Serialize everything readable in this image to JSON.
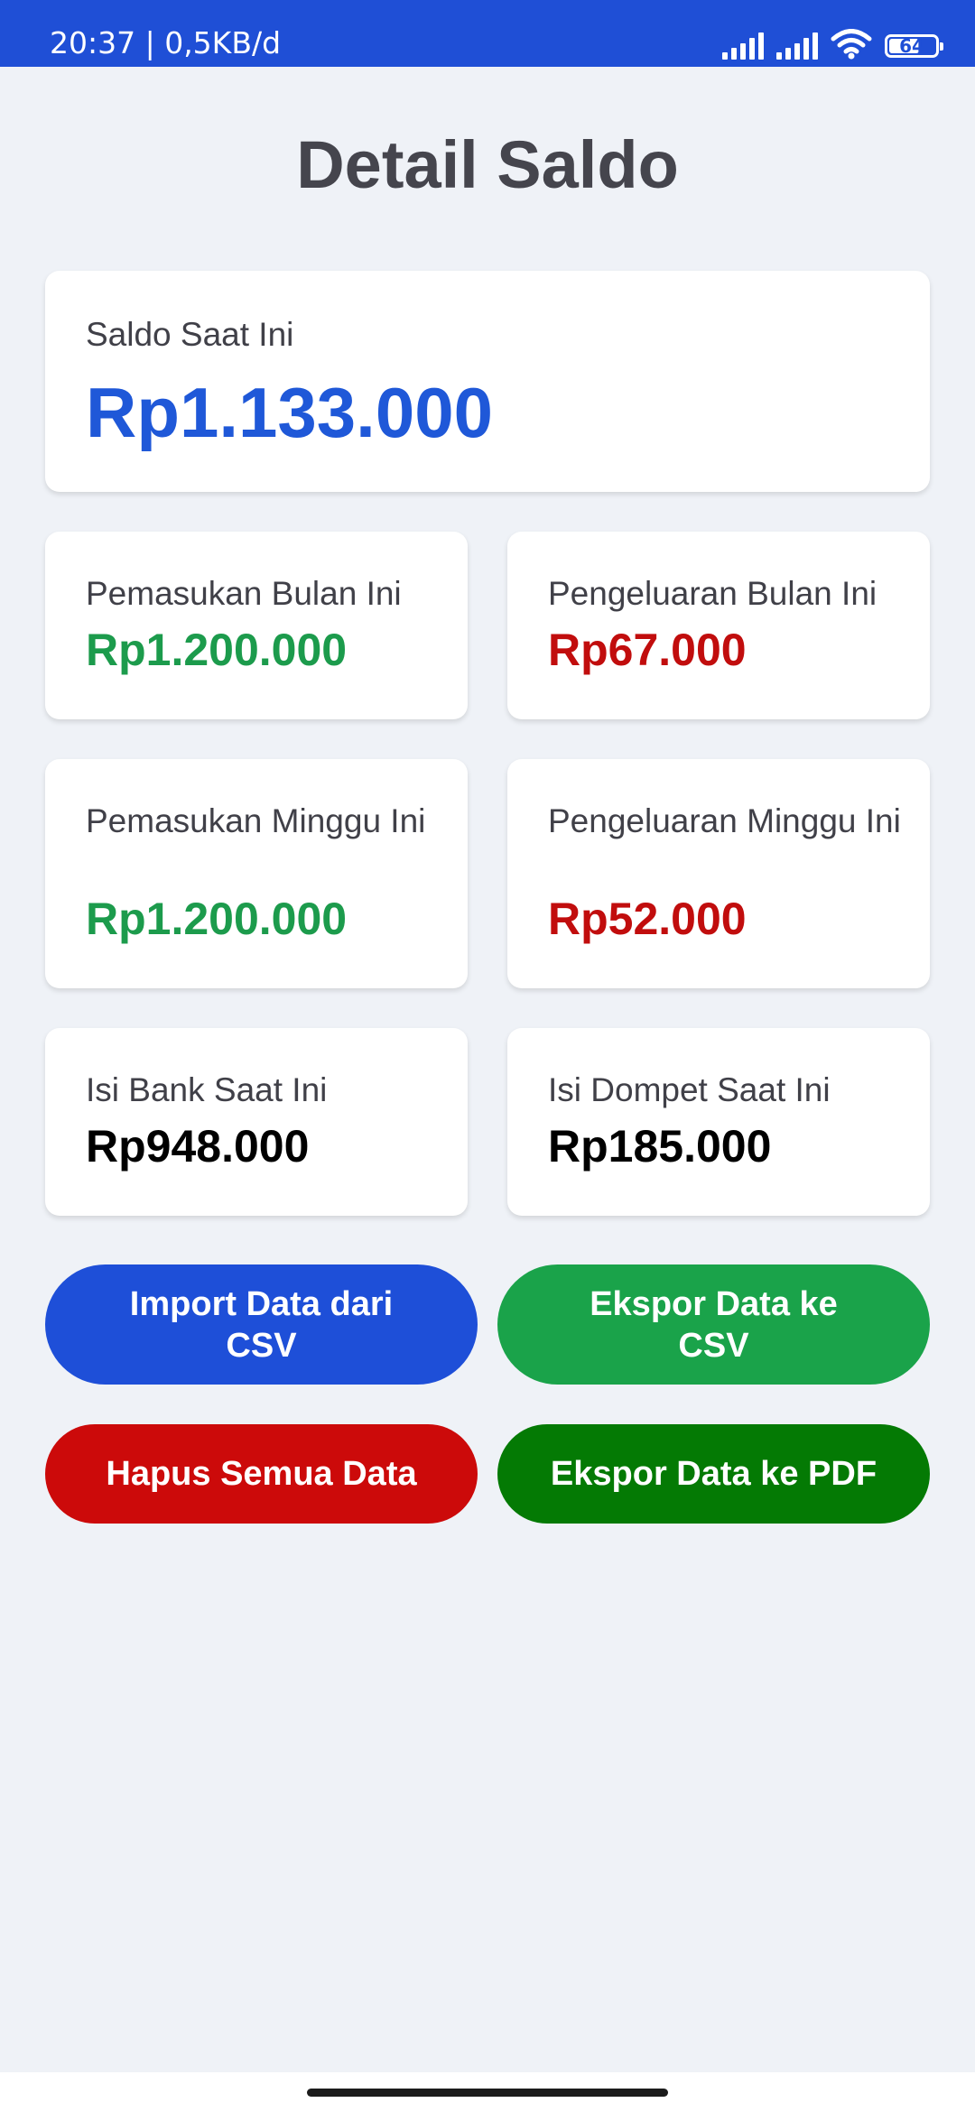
{
  "status_bar": {
    "text": "20:37 | 0,5KB/d",
    "battery_level": "64",
    "icons": [
      "signal-icon",
      "signal-icon",
      "wifi-icon",
      "battery-icon"
    ]
  },
  "page": {
    "title": "Detail Saldo"
  },
  "balance": {
    "label": "Saldo Saat Ini",
    "value": "Rp1.133.000",
    "color": "#1f58d8"
  },
  "stats": {
    "income_month": {
      "label": "Pemasukan Bulan Ini",
      "value": "Rp1.200.000",
      "color": "#1c9b4c"
    },
    "expense_month": {
      "label": "Pengeluaran Bulan Ini",
      "value": "Rp67.000",
      "color": "#c10d0d"
    },
    "income_week": {
      "label": "Pemasukan Minggu Ini",
      "value": "Rp1.200.000",
      "color": "#1c9b4c"
    },
    "expense_week": {
      "label": "Pengeluaran Minggu Ini",
      "value": "Rp52.000",
      "color": "#c10d0d"
    },
    "bank": {
      "label": "Isi Bank Saat Ini",
      "value": "Rp948.000",
      "color": "#000000"
    },
    "wallet": {
      "label": "Isi Dompet Saat Ini",
      "value": "Rp185.000",
      "color": "#000000"
    }
  },
  "actions": {
    "import_csv": {
      "label": "Import Data dari CSV",
      "color": "#1e4fd8"
    },
    "export_csv": {
      "label": "Ekspor Data ke CSV",
      "color": "#1aa34a"
    },
    "delete_all": {
      "label": "Hapus Semua Data",
      "color": "#cc0a0a"
    },
    "export_pdf": {
      "label": "Ekspor Data ke PDF",
      "color": "#047a04"
    }
  }
}
